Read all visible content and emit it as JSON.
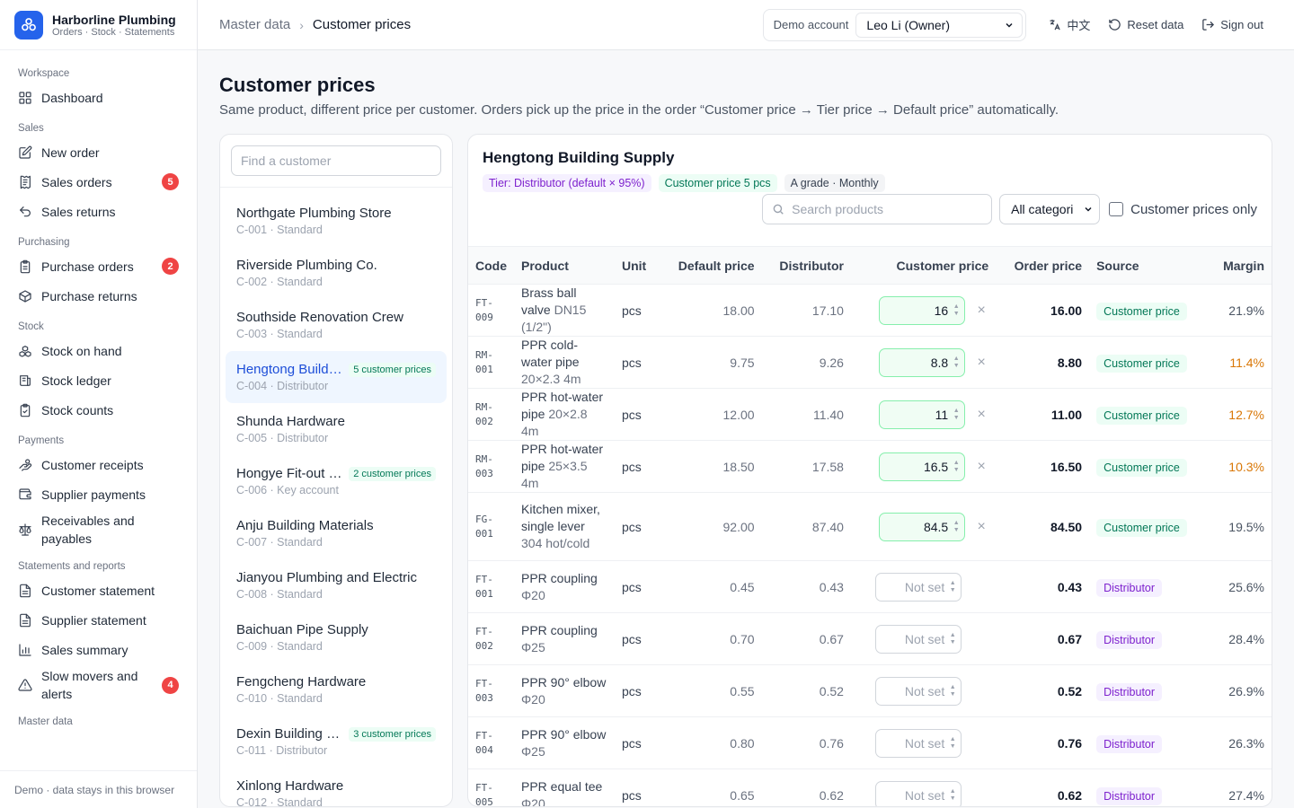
{
  "brand": {
    "name": "Harborline Plumbing",
    "subtitle": "Orders · Stock · Statements"
  },
  "nav": [
    {
      "group": "Workspace",
      "items": [
        {
          "label": "Dashboard",
          "icon": "grid-icon"
        }
      ]
    },
    {
      "group": "Sales",
      "items": [
        {
          "label": "New order",
          "icon": "edit-icon"
        },
        {
          "label": "Sales orders",
          "icon": "receipt-icon",
          "badge": "5"
        },
        {
          "label": "Sales returns",
          "icon": "return-icon"
        }
      ]
    },
    {
      "group": "Purchasing",
      "items": [
        {
          "label": "Purchase orders",
          "icon": "clipboard-icon",
          "badge": "2"
        },
        {
          "label": "Purchase returns",
          "icon": "package-icon"
        }
      ]
    },
    {
      "group": "Stock",
      "items": [
        {
          "label": "Stock on hand",
          "icon": "boxes-icon"
        },
        {
          "label": "Stock ledger",
          "icon": "ledger-icon"
        },
        {
          "label": "Stock counts",
          "icon": "clipboard-check-icon"
        }
      ]
    },
    {
      "group": "Payments",
      "items": [
        {
          "label": "Customer receipts",
          "icon": "hand-coins-icon"
        },
        {
          "label": "Supplier payments",
          "icon": "wallet-icon"
        },
        {
          "label": "Receivables and payables",
          "icon": "scale-icon"
        }
      ]
    },
    {
      "group": "Statements and reports",
      "items": [
        {
          "label": "Customer statement",
          "icon": "file-text-icon"
        },
        {
          "label": "Supplier statement",
          "icon": "file-text-icon"
        },
        {
          "label": "Sales summary",
          "icon": "bar-chart-icon"
        },
        {
          "label": "Slow movers and alerts",
          "icon": "alert-triangle-icon",
          "badge": "4"
        }
      ]
    },
    {
      "group": "Master data",
      "items": []
    }
  ],
  "sidebar_footer": "Demo · data stays in this browser",
  "topbar": {
    "breadcrumb_parent": "Master data",
    "breadcrumb_current": "Customer prices",
    "demo_label": "Demo account",
    "demo_value": "Leo Li (Owner)",
    "lang_label": "中文",
    "reset_label": "Reset data",
    "signout_label": "Sign out"
  },
  "page": {
    "title": "Customer prices",
    "description": "Same product, different price per customer. Orders pick up the price in the order “Customer price → Tier price → Default price” automatically."
  },
  "customer_search_placeholder": "Find a customer",
  "customers": [
    {
      "name": "Northgate Plumbing Store",
      "meta": "C-001 · Standard",
      "tag": ""
    },
    {
      "name": "Riverside Plumbing Co.",
      "meta": "C-002 · Standard",
      "tag": ""
    },
    {
      "name": "Southside Renovation Crew",
      "meta": "C-003 · Standard",
      "tag": ""
    },
    {
      "name": "Hengtong Building Supply",
      "meta": "C-004 · Distributor",
      "tag": "5 customer prices",
      "active": true
    },
    {
      "name": "Shunda Hardware",
      "meta": "C-005 · Distributor",
      "tag": ""
    },
    {
      "name": "Hongye Fit-out Works",
      "meta": "C-006 · Key account",
      "tag": "2 customer prices"
    },
    {
      "name": "Anju Building Materials",
      "meta": "C-007 · Standard",
      "tag": ""
    },
    {
      "name": "Jianyou Plumbing and Electric",
      "meta": "C-008 · Standard",
      "tag": ""
    },
    {
      "name": "Baichuan Pipe Supply",
      "meta": "C-009 · Standard",
      "tag": ""
    },
    {
      "name": "Fengcheng Hardware",
      "meta": "C-010 · Standard",
      "tag": ""
    },
    {
      "name": "Dexin Building Supply",
      "meta": "C-011 · Distributor",
      "tag": "3 customer prices"
    },
    {
      "name": "Xinlong Hardware",
      "meta": "C-012 · Standard",
      "tag": ""
    }
  ],
  "detail": {
    "customer_name": "Hengtong Building Supply",
    "chips": {
      "tier": "Tier: Distributor (default × 95%)",
      "count": "Customer price 5 pcs",
      "grade": "A grade · Monthly"
    },
    "product_search_placeholder": "Search products",
    "category_value": "All categori",
    "only_label": "Customer prices only",
    "columns": [
      "Code",
      "Product",
      "Unit",
      "Default price",
      "Distributor",
      "Customer price",
      "Order price",
      "Source",
      "Margin"
    ],
    "rows": [
      {
        "code": "FT-009",
        "name": "Brass ball valve",
        "spec": "DN15 (1/2\")",
        "unit": "pcs",
        "default": "18.00",
        "tier": "17.10",
        "customer": "16",
        "order": "16.00",
        "source": "Customer price",
        "margin": "21.9%",
        "warn": false
      },
      {
        "code": "RM-001",
        "name": "PPR cold-water pipe",
        "spec": "20×2.3 4m",
        "unit": "pcs",
        "default": "9.75",
        "tier": "9.26",
        "customer": "8.8",
        "order": "8.80",
        "source": "Customer price",
        "margin": "11.4%",
        "warn": true
      },
      {
        "code": "RM-002",
        "name": "PPR hot-water pipe",
        "spec": "20×2.8 4m",
        "unit": "pcs",
        "default": "12.00",
        "tier": "11.40",
        "customer": "11",
        "order": "11.00",
        "source": "Customer price",
        "margin": "12.7%",
        "warn": true
      },
      {
        "code": "RM-003",
        "name": "PPR hot-water pipe",
        "spec": "25×3.5 4m",
        "unit": "pcs",
        "default": "18.50",
        "tier": "17.58",
        "customer": "16.5",
        "order": "16.50",
        "source": "Customer price",
        "margin": "10.3%",
        "warn": true
      },
      {
        "code": "FG-001",
        "name": "Kitchen mixer, single lever",
        "spec": "304 hot/cold",
        "unit": "pcs",
        "default": "92.00",
        "tier": "87.40",
        "customer": "84.5",
        "order": "84.50",
        "source": "Customer price",
        "margin": "19.5%",
        "warn": false
      },
      {
        "code": "FT-001",
        "name": "PPR coupling",
        "spec": "Φ20",
        "unit": "pcs",
        "default": "0.45",
        "tier": "0.43",
        "customer": "",
        "order": "0.43",
        "source": "Distributor",
        "margin": "25.6%",
        "warn": false
      },
      {
        "code": "FT-002",
        "name": "PPR coupling",
        "spec": "Φ25",
        "unit": "pcs",
        "default": "0.70",
        "tier": "0.67",
        "customer": "",
        "order": "0.67",
        "source": "Distributor",
        "margin": "28.4%",
        "warn": false
      },
      {
        "code": "FT-003",
        "name": "PPR 90° elbow",
        "spec": "Φ20",
        "unit": "pcs",
        "default": "0.55",
        "tier": "0.52",
        "customer": "",
        "order": "0.52",
        "source": "Distributor",
        "margin": "26.9%",
        "warn": false
      },
      {
        "code": "FT-004",
        "name": "PPR 90° elbow",
        "spec": "Φ25",
        "unit": "pcs",
        "default": "0.80",
        "tier": "0.76",
        "customer": "",
        "order": "0.76",
        "source": "Distributor",
        "margin": "26.3%",
        "warn": false
      },
      {
        "code": "FT-005",
        "name": "PPR equal tee",
        "spec": "Φ20",
        "unit": "pcs",
        "default": "0.65",
        "tier": "0.62",
        "customer": "",
        "order": "0.62",
        "source": "Distributor",
        "margin": "27.4%",
        "warn": false
      }
    ],
    "not_set_label": "Not set"
  },
  "colors": {
    "accent": "#2563eb",
    "badge": "#ef4444",
    "customer_price": "#047857",
    "distributor": "#7e22ce",
    "warn": "#d97706"
  }
}
